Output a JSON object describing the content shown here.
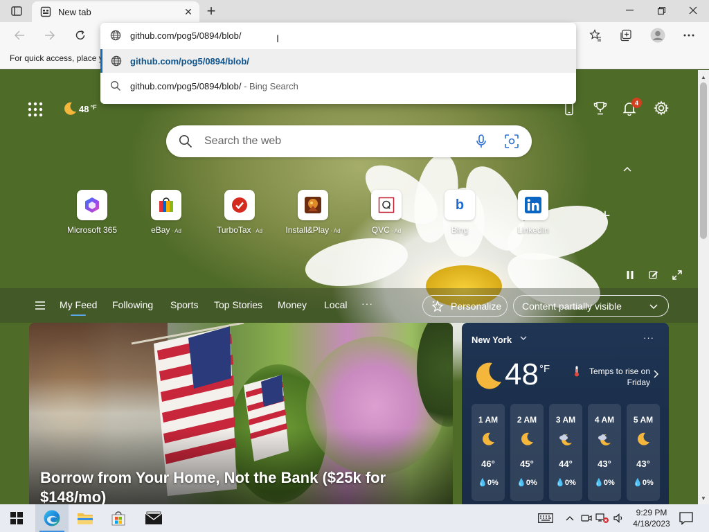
{
  "browser": {
    "tab_title": "New tab",
    "address_value": "github.com/pog5/0894/blob/",
    "fav_bar_text": "For quick access, place y"
  },
  "omnibox": {
    "suggestions": [
      {
        "text": "github.com/pog5/0894/blob/",
        "suffix": "",
        "icon": "globe-icon"
      },
      {
        "text": "github.com/pog5/0894/blob/",
        "suffix": " - Bing Search",
        "icon": "search-icon"
      }
    ]
  },
  "ntp": {
    "weather_temp": "48",
    "weather_unit": "°F",
    "notification_count": "4",
    "search_placeholder": "Search the web",
    "quick_links": [
      {
        "label": "Microsoft 365",
        "ad": ""
      },
      {
        "label": "eBay",
        "ad": " · Ad"
      },
      {
        "label": "TurboTax",
        "ad": " · Ad"
      },
      {
        "label": "Install&Play",
        "ad": " · Ad"
      },
      {
        "label": "QVC",
        "ad": " · Ad"
      },
      {
        "label": "Bing",
        "ad": ""
      },
      {
        "label": "LinkedIn",
        "ad": ""
      }
    ]
  },
  "feed": {
    "tabs": [
      "My Feed",
      "Following",
      "Sports",
      "Top Stories",
      "Money",
      "Local"
    ],
    "more": "···",
    "personalize_label": "Personalize",
    "content_visibility_label": "Content partially visible"
  },
  "hero": {
    "title": "Borrow from Your Home, Not the Bank ($25k for $148/mo)"
  },
  "weather": {
    "location": "New York",
    "temp": "48",
    "unit": "°F",
    "note": "Temps to rise on Friday",
    "hours": [
      {
        "time": "1 AM",
        "icon": "moon-icon",
        "temp": "46°",
        "precip": "0%"
      },
      {
        "time": "2 AM",
        "icon": "moon-icon",
        "temp": "45°",
        "precip": "0%"
      },
      {
        "time": "3 AM",
        "icon": "moon-cloud-icon",
        "temp": "44°",
        "precip": "0%"
      },
      {
        "time": "4 AM",
        "icon": "moon-cloud-icon",
        "temp": "43°",
        "precip": "0%"
      },
      {
        "time": "5 AM",
        "icon": "moon-icon",
        "temp": "43°",
        "precip": "0%"
      }
    ]
  },
  "taskbar": {
    "time": "9:29 PM",
    "date": "4/18/2023"
  },
  "colors": {
    "accent": "#0f6cbd",
    "badge": "#d1401f",
    "weather_card": "#1f3553"
  }
}
